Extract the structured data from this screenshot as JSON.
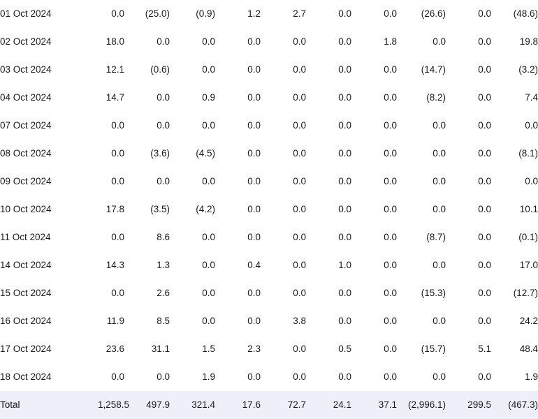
{
  "table": {
    "negative_color": "#ed3232",
    "text_color": "#1a1a1a",
    "total_row_background": "#eef0f9",
    "total_label": "Total",
    "rows": [
      {
        "date": "01 Oct 2024",
        "values": [
          "0.0",
          "(25.0)",
          "(0.9)",
          "1.2",
          "2.7",
          "0.0",
          "0.0",
          "(26.6)",
          "0.0",
          "(48.6)"
        ]
      },
      {
        "date": "02 Oct 2024",
        "values": [
          "18.0",
          "0.0",
          "0.0",
          "0.0",
          "0.0",
          "0.0",
          "1.8",
          "0.0",
          "0.0",
          "19.8"
        ]
      },
      {
        "date": "03 Oct 2024",
        "values": [
          "12.1",
          "(0.6)",
          "0.0",
          "0.0",
          "0.0",
          "0.0",
          "0.0",
          "(14.7)",
          "0.0",
          "(3.2)"
        ]
      },
      {
        "date": "04 Oct 2024",
        "values": [
          "14.7",
          "0.0",
          "0.9",
          "0.0",
          "0.0",
          "0.0",
          "0.0",
          "(8.2)",
          "0.0",
          "7.4"
        ]
      },
      {
        "date": "07 Oct 2024",
        "values": [
          "0.0",
          "0.0",
          "0.0",
          "0.0",
          "0.0",
          "0.0",
          "0.0",
          "0.0",
          "0.0",
          "0.0"
        ]
      },
      {
        "date": "08 Oct 2024",
        "values": [
          "0.0",
          "(3.6)",
          "(4.5)",
          "0.0",
          "0.0",
          "0.0",
          "0.0",
          "0.0",
          "0.0",
          "(8.1)"
        ]
      },
      {
        "date": "09 Oct 2024",
        "values": [
          "0.0",
          "0.0",
          "0.0",
          "0.0",
          "0.0",
          "0.0",
          "0.0",
          "0.0",
          "0.0",
          "0.0"
        ]
      },
      {
        "date": "10 Oct 2024",
        "values": [
          "17.8",
          "(3.5)",
          "(4.2)",
          "0.0",
          "0.0",
          "0.0",
          "0.0",
          "0.0",
          "0.0",
          "10.1"
        ]
      },
      {
        "date": "11 Oct 2024",
        "values": [
          "0.0",
          "8.6",
          "0.0",
          "0.0",
          "0.0",
          "0.0",
          "0.0",
          "(8.7)",
          "0.0",
          "(0.1)"
        ]
      },
      {
        "date": "14 Oct 2024",
        "values": [
          "14.3",
          "1.3",
          "0.0",
          "0.4",
          "0.0",
          "1.0",
          "0.0",
          "0.0",
          "0.0",
          "17.0"
        ]
      },
      {
        "date": "15 Oct 2024",
        "values": [
          "0.0",
          "2.6",
          "0.0",
          "0.0",
          "0.0",
          "0.0",
          "0.0",
          "(15.3)",
          "0.0",
          "(12.7)"
        ]
      },
      {
        "date": "16 Oct 2024",
        "values": [
          "11.9",
          "8.5",
          "0.0",
          "0.0",
          "3.8",
          "0.0",
          "0.0",
          "0.0",
          "0.0",
          "24.2"
        ]
      },
      {
        "date": "17 Oct 2024",
        "values": [
          "23.6",
          "31.1",
          "1.5",
          "2.3",
          "0.0",
          "0.5",
          "0.0",
          "(15.7)",
          "5.1",
          "48.4"
        ]
      },
      {
        "date": "18 Oct 2024",
        "values": [
          "0.0",
          "0.0",
          "1.9",
          "0.0",
          "0.0",
          "0.0",
          "0.0",
          "0.0",
          "0.0",
          "1.9"
        ]
      }
    ],
    "total": {
      "date": "Total",
      "values": [
        "1,258.5",
        "497.9",
        "321.4",
        "17.6",
        "72.7",
        "24.1",
        "37.1",
        "(2,996.1)",
        "299.5",
        "(467.3)"
      ]
    }
  }
}
